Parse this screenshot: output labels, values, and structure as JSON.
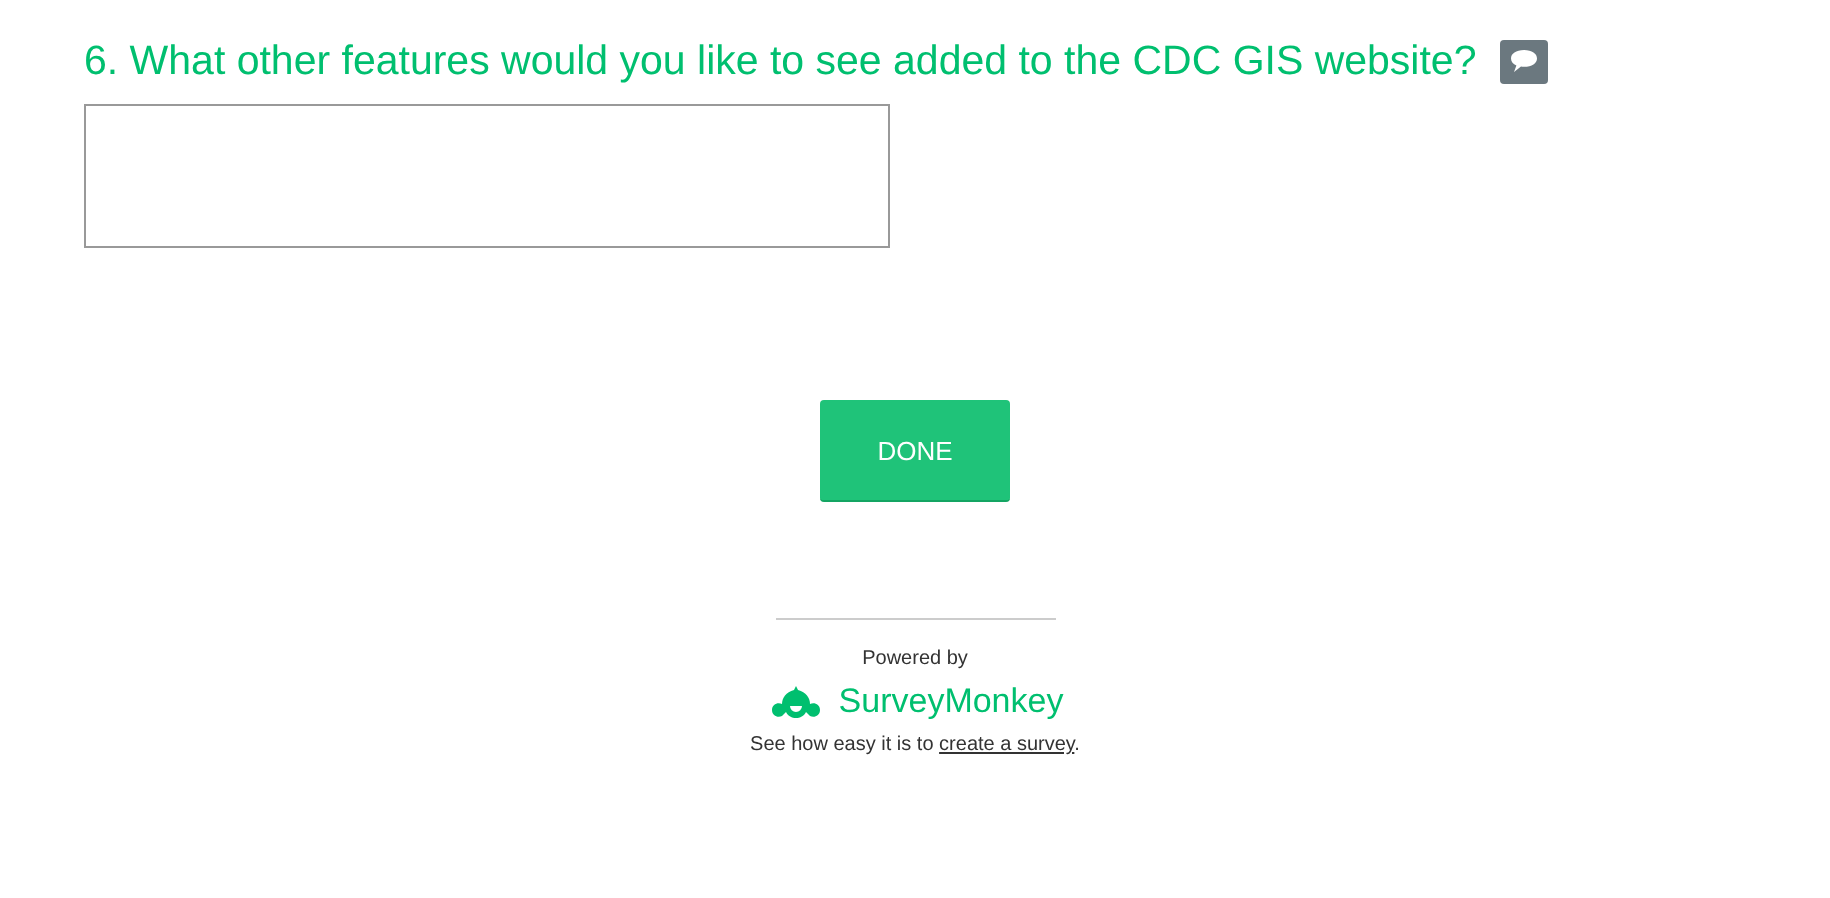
{
  "question": {
    "number": "6.",
    "text": "What other features would you like to see added to the CDC GIS website?",
    "has_comment_icon": true
  },
  "done_button": {
    "label": "DONE"
  },
  "footer": {
    "powered_by": "Powered by",
    "brand": "SurveyMonkey",
    "sentence_before": "See how easy it is to ",
    "link": "create a survey",
    "sentence_after": "."
  }
}
